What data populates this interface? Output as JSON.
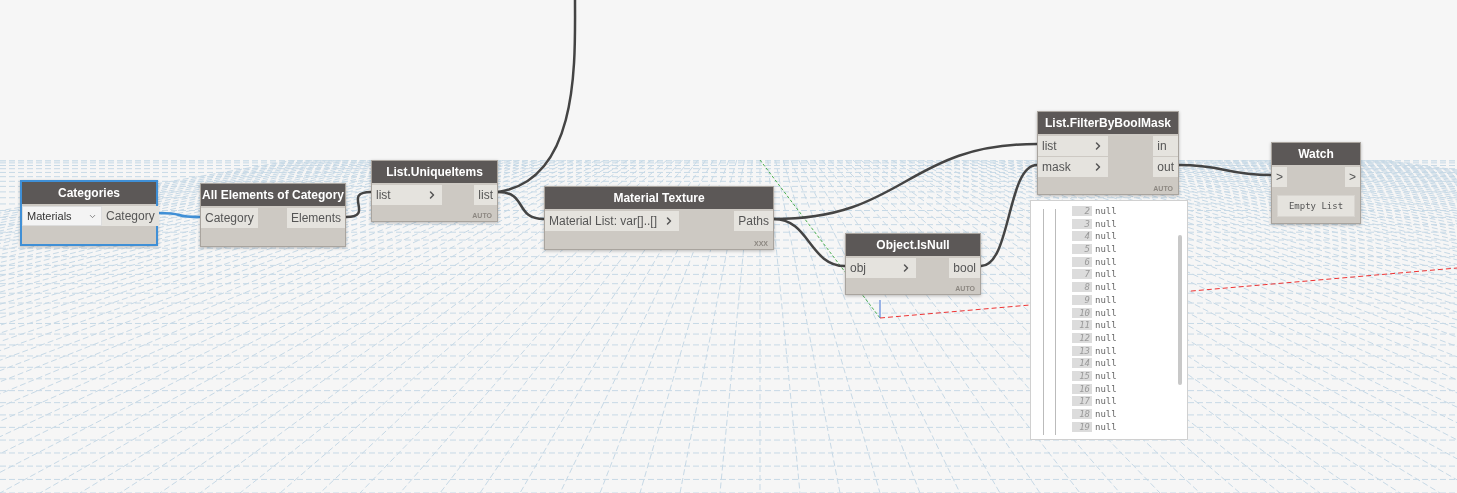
{
  "canvas": {
    "nodes": [
      {
        "kind": "dropdown",
        "title": "Categories",
        "selected": true,
        "dropdown": {
          "value": "Materials"
        },
        "outputs": [
          "Category"
        ]
      },
      {
        "kind": "function",
        "title": "All Elements of Category",
        "selected": false,
        "inputs": [
          {
            "label": "Category",
            "chevron": false
          }
        ],
        "outputs": [
          "Elements"
        ]
      },
      {
        "kind": "function",
        "title": "List.UniqueItems",
        "selected": false,
        "inputs": [
          {
            "label": "list",
            "chevron": true
          }
        ],
        "outputs": [
          "list"
        ],
        "lacing": "AUTO"
      },
      {
        "kind": "function",
        "title": "Material Texture",
        "selected": false,
        "inputs": [
          {
            "label": "Material List: var[]..[]",
            "chevron": true
          }
        ],
        "outputs": [
          "Paths"
        ],
        "lacing": "XXX"
      },
      {
        "kind": "function",
        "title": "Object.IsNull",
        "selected": false,
        "inputs": [
          {
            "label": "obj",
            "chevron": true
          }
        ],
        "outputs": [
          "bool"
        ],
        "lacing": "AUTO"
      },
      {
        "kind": "function",
        "title": "List.FilterByBoolMask",
        "selected": false,
        "inputs": [
          {
            "label": "list",
            "chevron": true
          },
          {
            "label": "mask",
            "chevron": true
          }
        ],
        "outputs": [
          "in",
          "out"
        ],
        "lacing": "AUTO"
      },
      {
        "kind": "watch",
        "title": "Watch",
        "selected": false,
        "inputs": [
          {
            "label": ">",
            "chevron": false
          }
        ],
        "outputs": [
          ">"
        ],
        "display": "Empty List"
      }
    ],
    "preview": {
      "rows": [
        {
          "index": "2",
          "value": "null"
        },
        {
          "index": "3",
          "value": "null"
        },
        {
          "index": "4",
          "value": "null"
        },
        {
          "index": "5",
          "value": "null"
        },
        {
          "index": "6",
          "value": "null"
        },
        {
          "index": "7",
          "value": "null"
        },
        {
          "index": "8",
          "value": "null"
        },
        {
          "index": "9",
          "value": "null"
        },
        {
          "index": "10",
          "value": "null"
        },
        {
          "index": "11",
          "value": "null"
        },
        {
          "index": "12",
          "value": "null"
        },
        {
          "index": "13",
          "value": "null"
        },
        {
          "index": "14",
          "value": "null"
        },
        {
          "index": "15",
          "value": "null"
        },
        {
          "index": "16",
          "value": "null"
        },
        {
          "index": "17",
          "value": "null"
        },
        {
          "index": "18",
          "value": "null"
        },
        {
          "index": "19",
          "value": "null"
        }
      ]
    }
  }
}
